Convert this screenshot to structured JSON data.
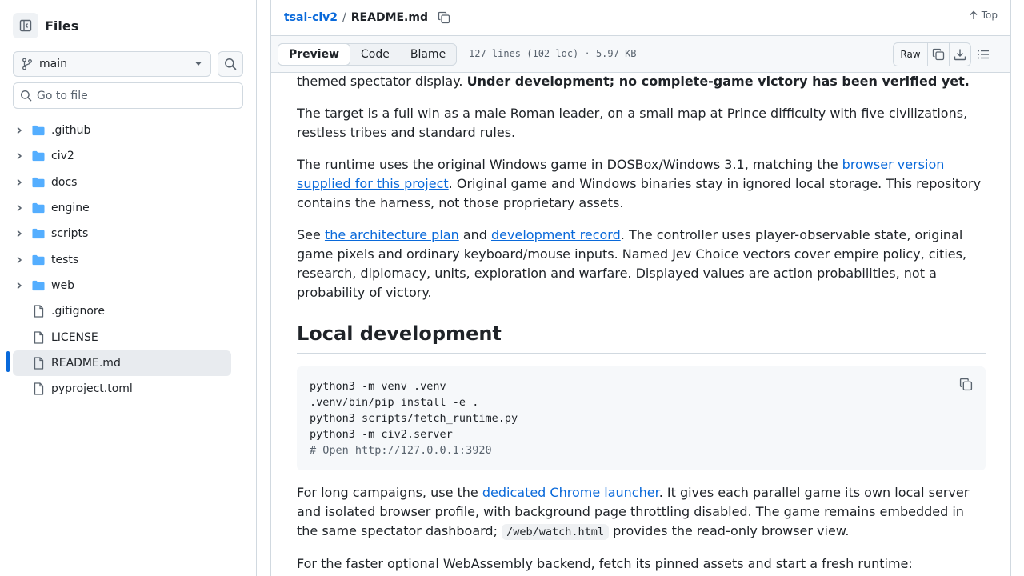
{
  "sidebar": {
    "title": "Files",
    "branch": "main",
    "search_placeholder": "Go to file",
    "items": [
      {
        "name": ".github",
        "type": "dir"
      },
      {
        "name": "civ2",
        "type": "dir"
      },
      {
        "name": "docs",
        "type": "dir"
      },
      {
        "name": "engine",
        "type": "dir"
      },
      {
        "name": "scripts",
        "type": "dir"
      },
      {
        "name": "tests",
        "type": "dir"
      },
      {
        "name": "web",
        "type": "dir"
      },
      {
        "name": ".gitignore",
        "type": "file"
      },
      {
        "name": "LICENSE",
        "type": "file"
      },
      {
        "name": "README.md",
        "type": "file",
        "active": true
      },
      {
        "name": "pyproject.toml",
        "type": "file"
      }
    ]
  },
  "header": {
    "repo": "tsai-civ2",
    "separator": "/",
    "file": "README.md",
    "top_label": "Top"
  },
  "toolbar": {
    "tabs": [
      "Preview",
      "Code",
      "Blame"
    ],
    "meta": "127 lines (102 loc) · 5.97 KB",
    "raw_label": "Raw"
  },
  "readme": {
    "p0_text": "themed spectator display. ",
    "p0_bold": "Under development; no complete-game victory has been verified yet.",
    "p1": "The target is a full win as a male Roman leader, on a small map at Prince difficulty with five civilizations, restless tribes and standard rules.",
    "p2_a": "The runtime uses the original Windows game in DOSBox/Windows 3.1, matching the ",
    "p2_link": "browser version supplied for this project",
    "p2_b": ". Original game and Windows binaries stay in ignored local storage. This repository contains the harness, not those proprietary assets.",
    "p3_a": "See ",
    "p3_link1": "the architecture plan",
    "p3_b": " and ",
    "p3_link2": "development record",
    "p3_c": ". The controller uses player-observable state, original game pixels and ordinary keyboard/mouse inputs. Named Jev Choice vectors cover empire policy, cities, research, diplomacy, units, exploration and warfare. Displayed values are action probabilities, not a probability of victory.",
    "h2": "Local development",
    "code": {
      "l1": "python3 -m venv .venv",
      "l2": ".venv/bin/pip install -e .",
      "l3": "python3 scripts/fetch_runtime.py",
      "l4": "python3 -m civ2.server",
      "l5": "# Open http://127.0.0.1:3920"
    },
    "p4_a": "For long campaigns, use the ",
    "p4_link": "dedicated Chrome launcher",
    "p4_b": ". It gives each parallel game its own local server and isolated browser profile, with background page throttling disabled. The game remains embedded in the same spectator dashboard; ",
    "p4_code": "/web/watch.html",
    "p4_c": " provides the read-only browser view.",
    "p5": "For the faster optional WebAssembly backend, fetch its pinned assets and start a fresh runtime:"
  },
  "colors": {
    "accent": "#0969da",
    "folder": "#54aeff",
    "text": "#1f2328",
    "muted": "#59636e"
  }
}
